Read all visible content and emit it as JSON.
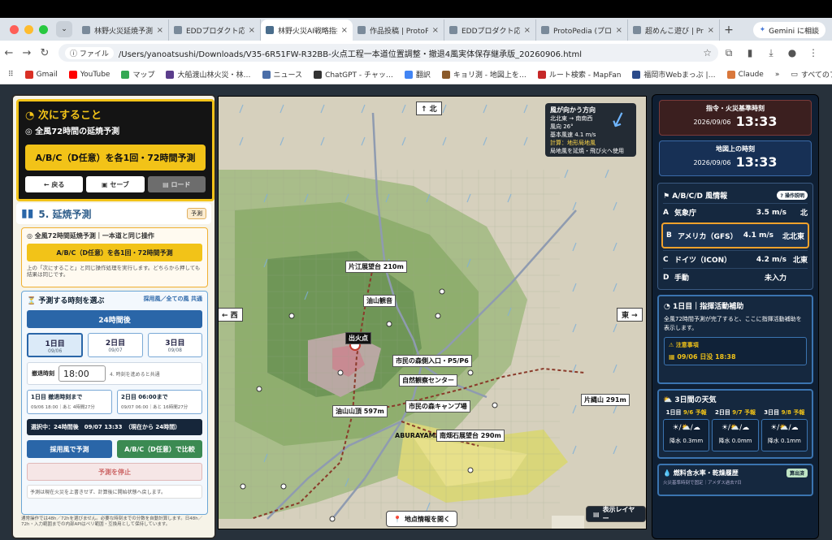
{
  "browser": {
    "tabs": [
      {
        "title": "林野火災延焼予測",
        "active": false
      },
      {
        "title": "EDDプロダクト応募",
        "active": false
      },
      {
        "title": "林野火災AI戦略指揮",
        "active": true
      },
      {
        "title": "作品投稿 | ProtoPe",
        "active": false
      },
      {
        "title": "EDDプロダクト応募",
        "active": false
      },
      {
        "title": "ProtoPedia (プロ",
        "active": false
      },
      {
        "title": "超めんこ遊び | Pro",
        "active": false
      }
    ],
    "gemini_label": "Gemini に相談",
    "url_scheme": "ファイル",
    "url": "/Users/yanoatsushi/Downloads/V35-6R51FW-R32BB-火点工程一本道位置調整・撤退4風実体保存継承版_20260906.html",
    "bookmarks": [
      "Gmail",
      "YouTube",
      "マップ",
      "大船渡山林火災・林…",
      "ニュース",
      "ChatGPT - チャッ…",
      "翻訳",
      "キョリ測 - 地図上を…",
      "ルート検索 - MapFan",
      "福岡市Webまっぷ |…",
      "Claude"
    ],
    "bookmarks_all": "すべてのブックマーク"
  },
  "left": {
    "next_title": "次にすること",
    "next_sub": "全風72時間の延焼予測",
    "next_btn": "A/B/C（D任意）を各1回・72時間予測",
    "back": "← 戻る",
    "save": "セーブ",
    "load": "ロード",
    "section_title": "5. 延焼予測",
    "section_tag": "予測",
    "box72_head": "全風72時間延焼予測｜一本道と同じ操作",
    "box72_btn": "A/B/C（D任意）を各1回・72時間予測",
    "box72_note": "上の「次にすること」と同じ操作処理を実行します。どちらから押しても結果は同じです。",
    "predict_head": "予測する時刻を選ぶ",
    "predict_right": "採用風／全ての風 共通",
    "btn24": "24時間後",
    "days": [
      {
        "label": "1日目",
        "date": "09/06"
      },
      {
        "label": "2日目",
        "date": "09/07"
      },
      {
        "label": "3日目",
        "date": "09/08"
      }
    ],
    "evac_label": "撤退時刻",
    "evac_time": "18:00",
    "evac_note": "4. 時刻を進めると共通",
    "until1": "1日目 撤退時刻まで",
    "until1_sub": "09/06 18:00｜あと 4時間27分",
    "until2": "2日目 06:00まで",
    "until2_sub": "09/07 06:00｜あと 16時間27分",
    "selected": "選択中：24時間後　09/07 13:33　（現在から 24時間）",
    "btn_adopt": "採用風で予測",
    "btn_compare": "A/B/C（D任意）で比較",
    "btn_stop": "予測を停止",
    "predict_note": "予測は現在火災を上書きせず、計算後に開始状態へ戻します。",
    "bottom_note": "通常操作では48h／72hを選びません。必要な時刻までの分数を自動計算します。日48h／72h・入力範囲までの内部APIはペリ範囲・互換用として保持しています。"
  },
  "map": {
    "north": "↑ 北",
    "west": "← 西",
    "east": "東 →",
    "labels": {
      "lookout": "片江展望台 210m",
      "temple": "油山観音",
      "fire": "出火点",
      "forest_entry": "市民の森側入口・P5/P6",
      "nature_center": "自然観察センター",
      "camp": "市民の森キャンプ場",
      "summit": "油山山頂 597m",
      "katabuta": "片縄山 291m",
      "aburayama": "ABURAYAMA",
      "minamikata": "南畑石展望台 290m",
      "fire_mark": "出"
    },
    "wind": {
      "head": "風が向かう方向",
      "dir": "北北東 → 南南西",
      "angle": "風向 26°",
      "speed": "基本風速 4.1 m/s",
      "calc": "計算：地形局地風",
      "note": "局地風を延焼・飛び火へ使用"
    },
    "btn_info": "地点情報を開く",
    "btn_layer": "表示レイヤー"
  },
  "right": {
    "cmd_label": "指令・火災基準時刻",
    "cmd_date": "2026/09/06",
    "cmd_time": "13:33",
    "map_label": "地図上の時刻",
    "map_date": "2026/09/06",
    "map_time": "13:33",
    "wind_head": "A/B/C/D 風情報",
    "wind_help": "? 操作説明",
    "winds": [
      {
        "letter": "A",
        "name": "気象庁",
        "speed": "3.5 m/s",
        "dir": "北"
      },
      {
        "letter": "B",
        "name": "アメリカ（GFS）",
        "speed": "4.1 m/s",
        "dir": "北北東"
      },
      {
        "letter": "C",
        "name": "ドイツ（ICON）",
        "speed": "4.2 m/s",
        "dir": "北東"
      },
      {
        "letter": "D",
        "name": "手動",
        "speed": "未入力",
        "dir": ""
      }
    ],
    "cmd_day": "1日目｜指揮活動補助",
    "cmd_text": "全風72時間予測が完了すると、ここに指揮活動補助を表示します。",
    "caution_h": "注意事項",
    "caution_v": "09/06 日没 18:38",
    "weather_head": "3日間の天気",
    "weather": [
      {
        "label": "1日目",
        "date": "9/6",
        "tag": "予報",
        "icon": "☀/⛅/☁",
        "rain": "降水 0.3mm"
      },
      {
        "label": "2日目",
        "date": "9/7",
        "tag": "予報",
        "icon": "☀/⛅/☁",
        "rain": "降水 0.0mm"
      },
      {
        "label": "3日目",
        "date": "9/8",
        "tag": "予報",
        "icon": "☀/⛅/☁",
        "rain": "降水 0.1mm"
      }
    ],
    "fuel_head": "燃料含水率・乾燥履歴",
    "fuel_tag": "算出済",
    "fuel_sub": "火災基準時刻で固定｜アメダス過去7日"
  },
  "colors": {
    "accent_yellow": "#f2c318",
    "panel_blue": "#2a66a8",
    "dark_navy": "#0f1f33"
  }
}
